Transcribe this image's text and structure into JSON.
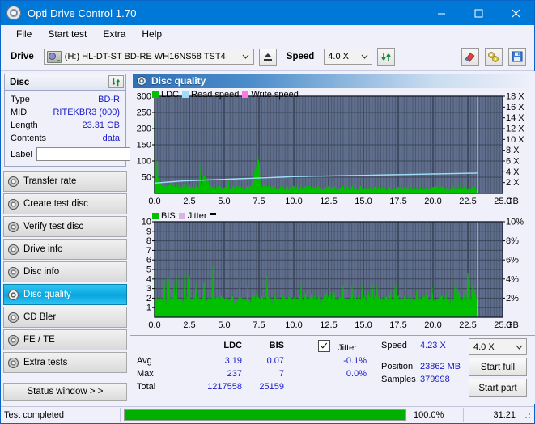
{
  "window": {
    "title": "Opti Drive Control 1.70",
    "icon": "disc-icon",
    "minimize": "minimize",
    "maximize": "maximize",
    "close": "close"
  },
  "menu": {
    "items": [
      "File",
      "Start test",
      "Extra",
      "Help"
    ]
  },
  "toolbar": {
    "drive_label": "Drive",
    "drive_value": "(H:)  HL-DT-ST BD-RE  WH16NS58 TST4",
    "eject": "eject-icon",
    "speed_label": "Speed",
    "speed_value": "4.0 X",
    "refresh": "refresh-icon",
    "erase": "eraser-icon",
    "tools": "tools-icon",
    "save": "save-icon"
  },
  "disc": {
    "header": "Disc",
    "refresh": "refresh-icon",
    "rows": [
      {
        "key": "Type",
        "value": "BD-R"
      },
      {
        "key": "MID",
        "value": "RITEKBR3 (000)"
      },
      {
        "key": "Length",
        "value": "23.31 GB"
      },
      {
        "key": "Contents",
        "value": "data"
      }
    ],
    "label_key": "Label",
    "label_value": "",
    "label_placeholder": ""
  },
  "nav": {
    "items": [
      {
        "label": "Transfer rate",
        "selected": false
      },
      {
        "label": "Create test disc",
        "selected": false
      },
      {
        "label": "Verify test disc",
        "selected": false
      },
      {
        "label": "Drive info",
        "selected": false
      },
      {
        "label": "Disc info",
        "selected": false
      },
      {
        "label": "Disc quality",
        "selected": true
      },
      {
        "label": "CD Bler",
        "selected": false
      },
      {
        "label": "FE / TE",
        "selected": false
      },
      {
        "label": "Extra tests",
        "selected": false
      }
    ],
    "status_window": "Status window > >"
  },
  "panel": {
    "title": "Disc quality",
    "icon": "disc-quality-icon"
  },
  "stats": {
    "col_ldc": "LDC",
    "col_bis": "BIS",
    "jitter_label": "Jitter",
    "jitter_checked": true,
    "rows": [
      {
        "name": "Avg",
        "ldc": "3.19",
        "bis": "0.07",
        "jitter": "-0.1%"
      },
      {
        "name": "Max",
        "ldc": "237",
        "bis": "7",
        "jitter": "0.0%"
      },
      {
        "name": "Total",
        "ldc": "1217558",
        "bis": "25159",
        "jitter": ""
      }
    ],
    "speed_label": "Speed",
    "speed_value": "4.23 X",
    "position_label": "Position",
    "position_value": "23862 MB",
    "samples_label": "Samples",
    "samples_value": "379998",
    "speed_select": "4.0 X",
    "start_full": "Start full",
    "start_part": "Start part"
  },
  "statusbar": {
    "message": "Test completed",
    "progress_text": "100.0%",
    "progress_value": 100,
    "elapsed": "31:21"
  },
  "colors": {
    "accent": "#0078d7",
    "ldc_green": "#00c000",
    "read_speed": "#9fdcf5",
    "write_speed": "#ff7ae0",
    "jitter": "#d8b4e2",
    "plot_bg": "#5f6e8c",
    "value_blue": "#1919c8",
    "progress_green": "#00b000"
  },
  "chart_data": [
    {
      "type": "area",
      "name": "ldc-chart",
      "title": "",
      "xlabel": "GB",
      "ylabel": "",
      "xlim": [
        0,
        25
      ],
      "ylim": [
        0,
        300
      ],
      "y2lim": [
        0,
        18
      ],
      "y2label": "X",
      "grid": true,
      "legend": [
        "LDC",
        "Read speed",
        "Write speed"
      ],
      "legend_position": "top-left",
      "xticks": [
        "0.0",
        "2.5",
        "5.0",
        "7.5",
        "10.0",
        "12.5",
        "15.0",
        "17.5",
        "20.0",
        "22.5",
        "25.0"
      ],
      "yticks": [
        "300",
        "250",
        "200",
        "150",
        "100",
        "50"
      ],
      "y2ticks": [
        "18 X",
        "16 X",
        "14 X",
        "12 X",
        "10 X",
        "8 X",
        "6 X",
        "4 X",
        "2 X"
      ],
      "series": [
        {
          "name": "LDC",
          "color": "#00c000",
          "kind": "area",
          "x": [
            0.0,
            0.1,
            0.2,
            0.3,
            0.4,
            0.6,
            0.8,
            1.0,
            1.3,
            1.6,
            1.9,
            2.2,
            2.5,
            2.9,
            3.2,
            3.6,
            4.0,
            4.3,
            4.6,
            5.0,
            5.4,
            5.8,
            6.2,
            6.6,
            7.0,
            7.4,
            7.6,
            7.9,
            8.2,
            8.6,
            9.0,
            9.4,
            9.8,
            10.2,
            10.6,
            11.0,
            11.4,
            11.8,
            12.2,
            12.6,
            13.0,
            13.4,
            13.8,
            14.2,
            14.6,
            15.0,
            15.4,
            15.8,
            16.2,
            16.6,
            17.0,
            17.4,
            17.8,
            18.2,
            18.6,
            19.0,
            19.4,
            19.8,
            20.2,
            20.6,
            21.0,
            21.4,
            21.8,
            22.2,
            22.6,
            23.0,
            23.2
          ],
          "values": [
            235,
            40,
            100,
            34,
            30,
            28,
            26,
            25,
            24,
            23,
            23,
            22,
            22,
            22,
            22,
            55,
            22,
            21,
            21,
            21,
            20,
            20,
            20,
            20,
            20,
            152,
            20,
            20,
            20,
            19,
            19,
            19,
            19,
            19,
            19,
            18,
            18,
            18,
            18,
            18,
            18,
            18,
            18,
            18,
            18,
            18,
            18,
            18,
            18,
            18,
            18,
            18,
            18,
            18,
            18,
            18,
            18,
            18,
            18,
            18,
            18,
            18,
            18,
            18,
            18,
            18,
            18
          ]
        },
        {
          "name": "Read speed",
          "color": "#9fdcf5",
          "kind": "line",
          "axis": "y2",
          "x": [
            0.0,
            0.5,
            1.0,
            2.0,
            3.0,
            4.0,
            5.0,
            6.0,
            7.0,
            8.0,
            9.0,
            10.0,
            11.0,
            12.0,
            13.0,
            14.0,
            15.0,
            16.0,
            17.0,
            18.0,
            19.0,
            20.0,
            21.0,
            22.0,
            23.0,
            23.2
          ],
          "values": [
            1.9,
            2.0,
            2.1,
            2.3,
            2.4,
            2.5,
            2.6,
            2.7,
            2.8,
            2.9,
            3.0,
            3.1,
            3.15,
            3.2,
            3.25,
            3.3,
            3.35,
            3.4,
            3.45,
            3.5,
            3.55,
            3.6,
            3.65,
            3.7,
            3.75,
            3.78
          ]
        },
        {
          "name": "Write speed",
          "color": "#ff7ae0",
          "kind": "line",
          "x": [],
          "values": []
        }
      ]
    },
    {
      "type": "area",
      "name": "bis-chart",
      "title": "",
      "xlabel": "GB",
      "ylabel": "",
      "xlim": [
        0,
        25
      ],
      "ylim": [
        0,
        10
      ],
      "y2lim": [
        0,
        10
      ],
      "y2label": "%",
      "grid": true,
      "legend": [
        "BIS",
        "Jitter"
      ],
      "legend_position": "top-left",
      "xticks": [
        "0.0",
        "2.5",
        "5.0",
        "7.5",
        "10.0",
        "12.5",
        "15.0",
        "17.5",
        "20.0",
        "22.5",
        "25.0"
      ],
      "yticks": [
        "10",
        "9",
        "8",
        "7",
        "6",
        "5",
        "4",
        "3",
        "2",
        "1"
      ],
      "y2ticks": [
        "10%",
        "8%",
        "6%",
        "4%",
        "2%"
      ],
      "series": [
        {
          "name": "BIS",
          "color": "#00c000",
          "kind": "area",
          "baseline": 2,
          "spike_max": 4,
          "x": [
            0.0,
            0.3,
            0.6,
            0.9,
            1.2,
            1.5,
            1.8,
            2.1,
            2.4,
            2.7,
            3.0,
            3.3,
            3.6,
            3.9,
            4.2,
            4.5,
            4.8,
            5.1,
            5.4,
            5.7,
            6.0,
            6.3,
            6.6,
            6.9,
            7.2,
            7.5,
            7.8,
            8.1,
            8.4,
            8.7,
            9.0,
            9.3,
            9.6,
            9.9,
            10.2,
            10.5,
            10.8,
            11.1,
            11.4,
            11.7,
            12.0,
            12.3,
            12.6,
            12.9,
            13.2,
            13.5,
            13.8,
            14.1,
            14.4,
            14.7,
            15.0,
            15.3,
            15.6,
            15.9,
            16.2,
            16.5,
            16.8,
            17.1,
            17.4,
            17.7,
            18.0,
            18.3,
            18.6,
            18.9,
            19.2,
            19.5,
            19.8,
            20.1,
            20.4,
            20.7,
            21.0,
            21.3,
            21.6,
            21.9,
            22.2,
            22.5,
            22.8,
            23.1,
            23.2
          ],
          "values": [
            4,
            3,
            3,
            4,
            3,
            3,
            3,
            3,
            4,
            3,
            3,
            3,
            3,
            3,
            4,
            3,
            3,
            2,
            3,
            2,
            3,
            2,
            3,
            2,
            2,
            2,
            2,
            3,
            2,
            2,
            3,
            2,
            2,
            2,
            2,
            3,
            2,
            2,
            2,
            2,
            3,
            2,
            2,
            2,
            2,
            2,
            2,
            3,
            2,
            2,
            2,
            2,
            3,
            2,
            2,
            2,
            2,
            2,
            3,
            2,
            2,
            2,
            3,
            2,
            2,
            2,
            2,
            2,
            3,
            2,
            2,
            2,
            3,
            2,
            2,
            4,
            3,
            2,
            2
          ]
        },
        {
          "name": "Jitter",
          "color": "#d8b4e2",
          "kind": "line",
          "x": [],
          "values": []
        }
      ]
    }
  ]
}
